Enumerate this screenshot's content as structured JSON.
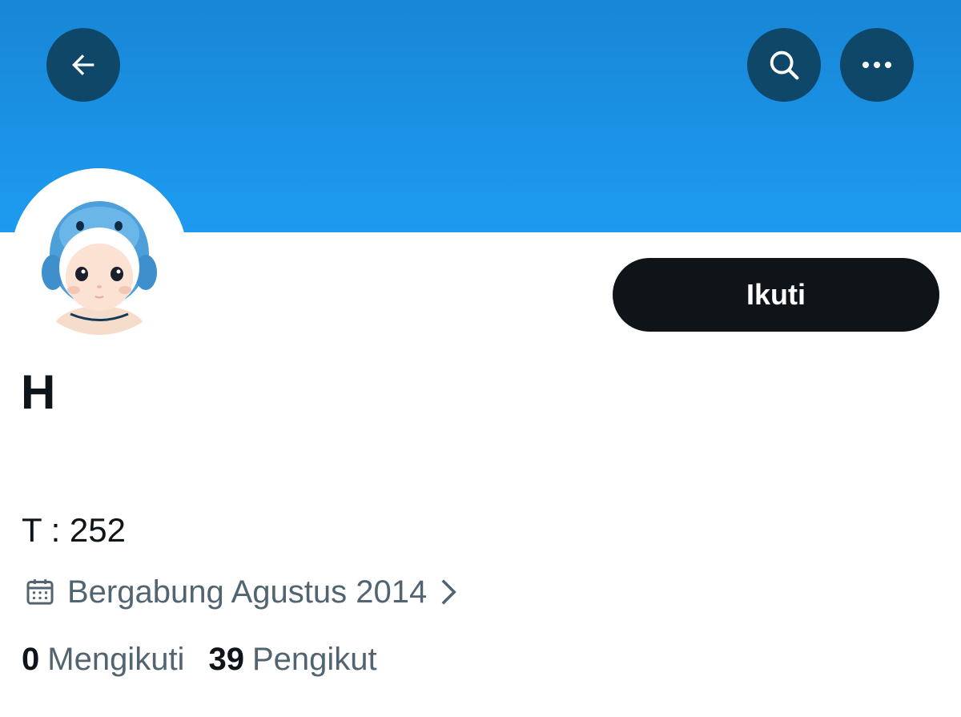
{
  "header": {
    "back_icon": "arrow-left-icon",
    "search_icon": "search-icon",
    "more_icon": "more-horizontal-icon",
    "banner_color": "#1d9bf0",
    "button_bg": "#0f4769"
  },
  "profile": {
    "avatar": "doll-avatar",
    "display_name": "H",
    "bio": "T : 252",
    "joined_text": "Bergabung Agustus 2014",
    "calendar_icon": "calendar-icon",
    "chevron_icon": "chevron-right-icon"
  },
  "actions": {
    "follow_label": "Ikuti"
  },
  "stats": {
    "following_count": "0",
    "following_label": "Mengikuti",
    "followers_count": "39",
    "followers_label": "Pengikut"
  },
  "colors": {
    "text_primary": "#0f1419",
    "text_secondary": "#536471",
    "follow_button_bg": "#0f1419"
  }
}
